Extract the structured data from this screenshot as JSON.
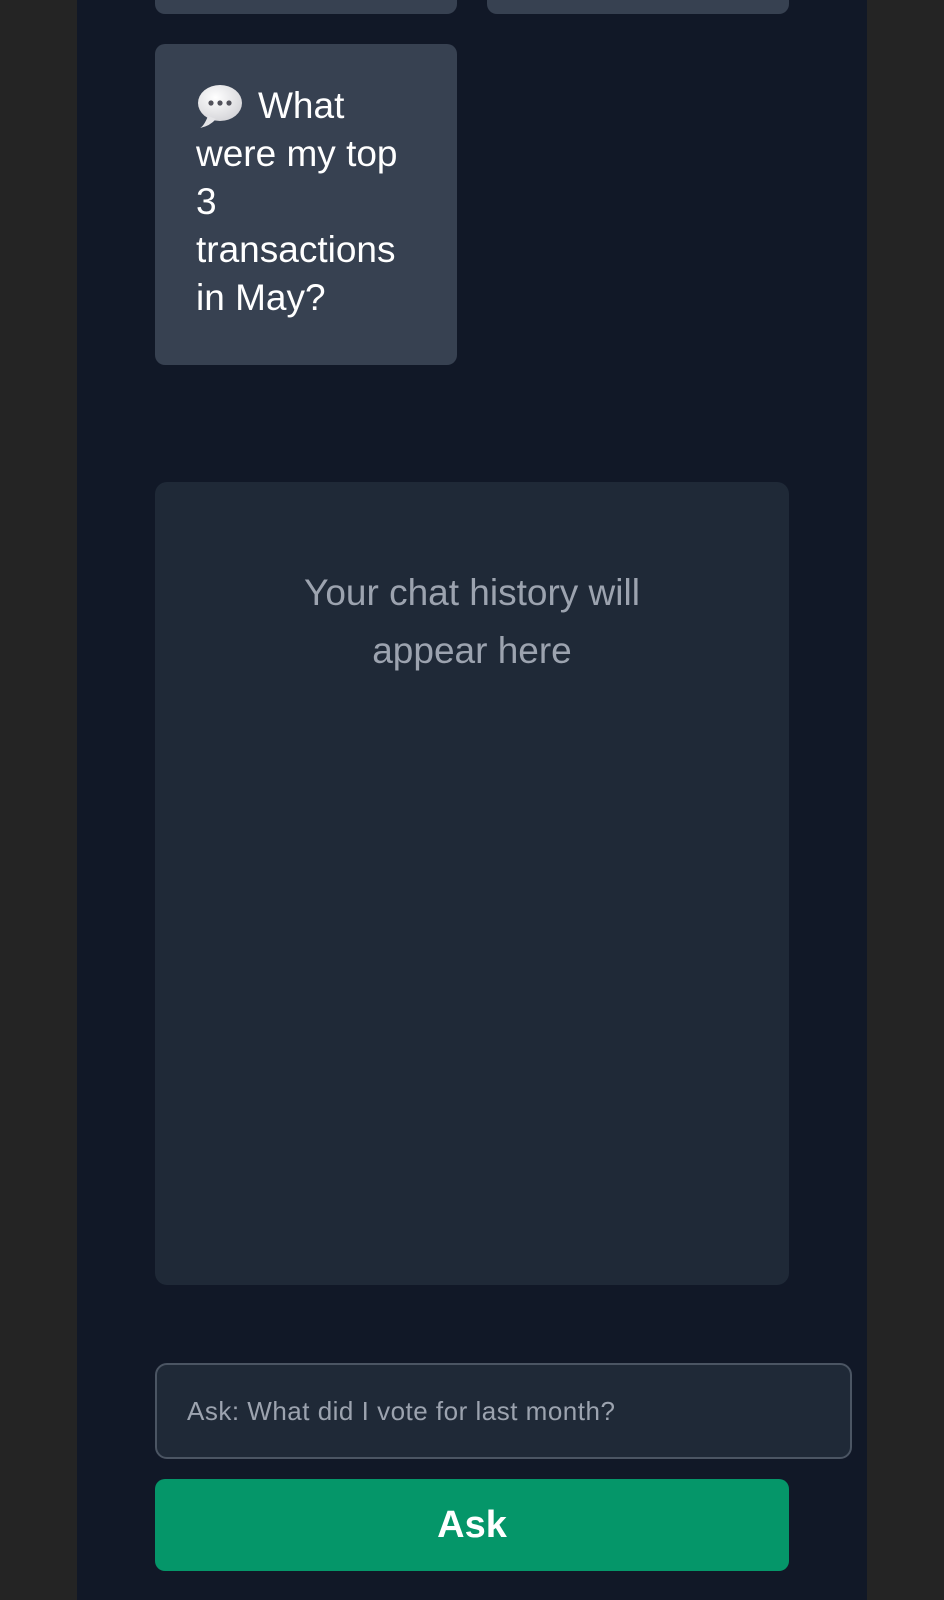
{
  "suggestions": {
    "items": [
      {
        "icon": "speech-bubble-icon",
        "text": "What were my top 3 transactions in May?"
      }
    ]
  },
  "history": {
    "placeholder": "Your chat history will appear here"
  },
  "input": {
    "placeholder": "Ask: What did I vote for last month?",
    "value": ""
  },
  "ask_button": {
    "label": "Ask"
  },
  "colors": {
    "page_background": "#242424",
    "app_background": "#111827",
    "chip_background": "#374151",
    "panel_background": "#1f2937",
    "accent": "#059669"
  }
}
